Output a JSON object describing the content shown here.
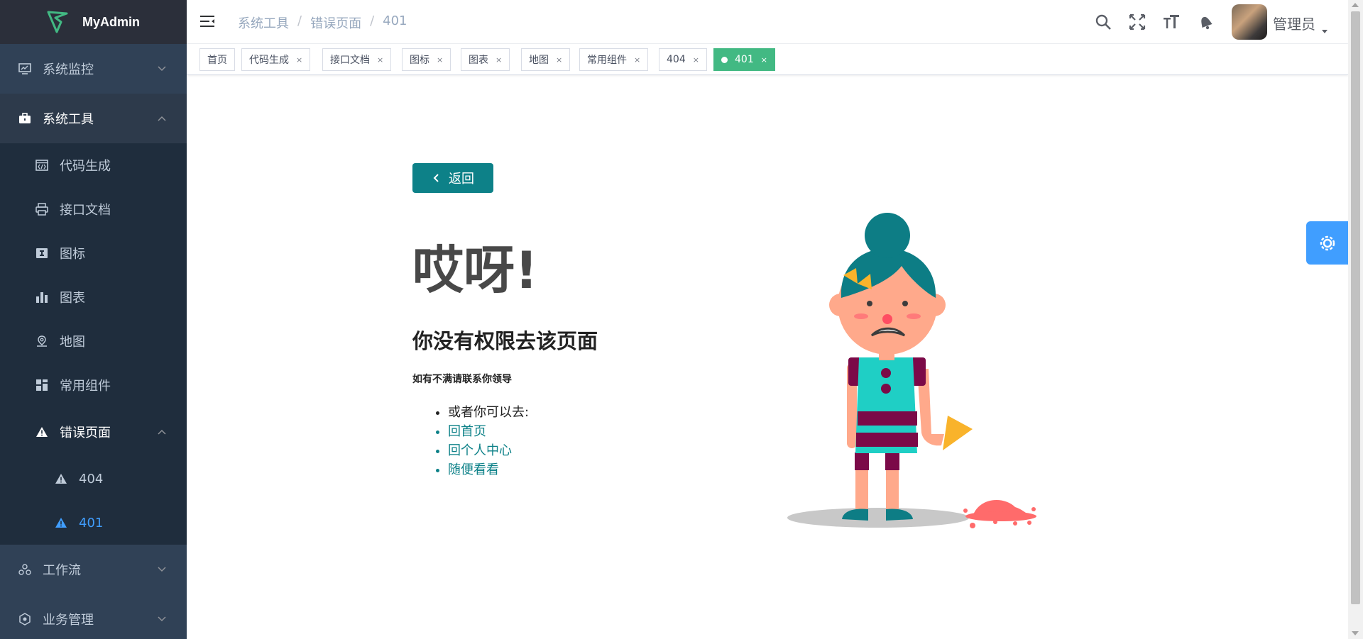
{
  "app": {
    "title": "MyAdmin"
  },
  "colors": {
    "sidebar_bg": "#304156",
    "logo_bg": "#2b2f3a",
    "accent_teal": "#0d8188",
    "active_tag": "#42b983",
    "active_menu": "#409eff"
  },
  "sidebar": {
    "items": [
      {
        "label": "系统监控",
        "icon": "monitor-icon",
        "expanded": false
      },
      {
        "label": "系统工具",
        "icon": "toolbox-icon",
        "expanded": true,
        "children": [
          {
            "label": "代码生成",
            "icon": "code-icon"
          },
          {
            "label": "接口文档",
            "icon": "printer-icon"
          },
          {
            "label": "图标",
            "icon": "icon-font-icon"
          },
          {
            "label": "图表",
            "icon": "bar-chart-icon"
          },
          {
            "label": "地图",
            "icon": "map-pin-icon"
          },
          {
            "label": "常用组件",
            "icon": "grid-icon"
          },
          {
            "label": "错误页面",
            "icon": "warning-icon",
            "expanded": true,
            "children": [
              {
                "label": "404",
                "icon": "warning-icon",
                "active": false
              },
              {
                "label": "401",
                "icon": "warning-icon",
                "active": true
              }
            ]
          }
        ]
      },
      {
        "label": "工作流",
        "icon": "workflow-icon",
        "expanded": false
      },
      {
        "label": "业务管理",
        "icon": "gear-cube-icon",
        "expanded": false
      }
    ]
  },
  "breadcrumb": {
    "items": [
      "系统工具",
      "错误页面",
      "401"
    ],
    "separator": "/"
  },
  "navbar": {
    "username": "管理员",
    "tools": [
      "search-icon",
      "fullscreen-icon",
      "font-size-icon",
      "bell-icon"
    ]
  },
  "tags": [
    {
      "label": "首页",
      "closable": false,
      "active": false
    },
    {
      "label": "代码生成",
      "closable": true,
      "active": false
    },
    {
      "label": "接口文档",
      "closable": true,
      "active": false
    },
    {
      "label": "图标",
      "closable": true,
      "active": false
    },
    {
      "label": "图表",
      "closable": true,
      "active": false
    },
    {
      "label": "地图",
      "closable": true,
      "active": false
    },
    {
      "label": "常用组件",
      "closable": true,
      "active": false
    },
    {
      "label": "404",
      "closable": true,
      "active": false
    },
    {
      "label": "401",
      "closable": true,
      "active": true
    }
  ],
  "close_glyph": "×",
  "error_page": {
    "back_label": "返回",
    "headline": "哎呀!",
    "sub_headline": "你没有权限去该页面",
    "notice": "如有不满请联系你领导",
    "options_intro": "或者你可以去:",
    "links": [
      "回首页",
      "回个人中心",
      "随便看看"
    ]
  }
}
